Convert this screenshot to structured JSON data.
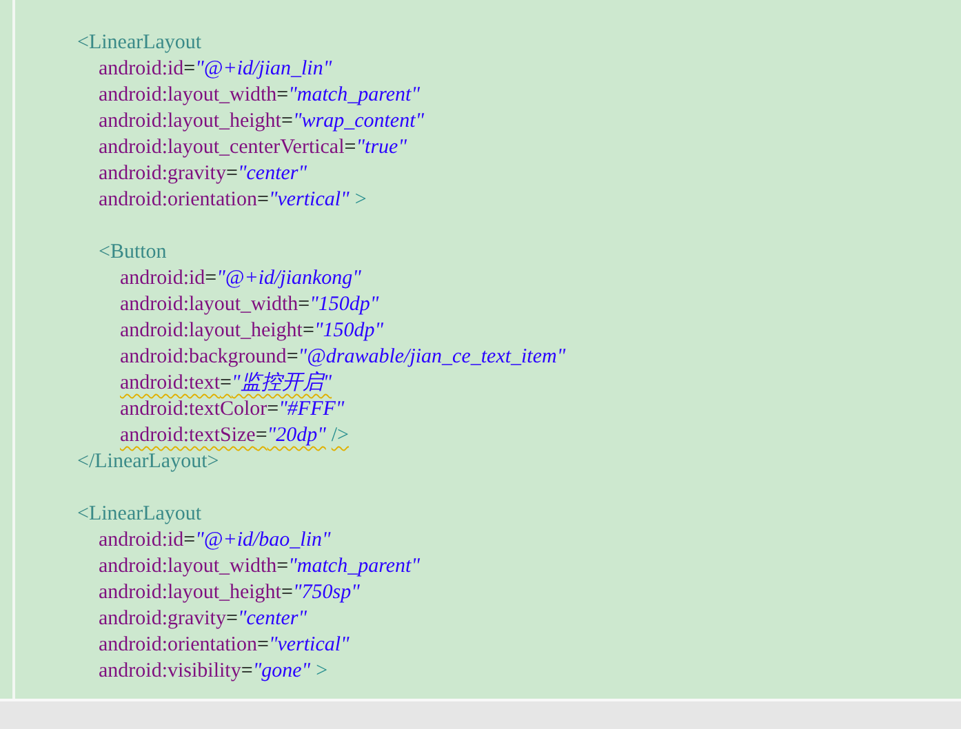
{
  "editor": {
    "lines": [
      {
        "kind": "open",
        "tokens": [
          {
            "kind": "tag",
            "text": "<LinearLayout"
          }
        ],
        "children": [
          {
            "kind": "attr",
            "tokens": [
              {
                "kind": "attr",
                "text": "android:id"
              },
              {
                "kind": "eq",
                "text": "="
              },
              {
                "kind": "value",
                "text": "\"@+id/jian_lin\""
              }
            ]
          },
          {
            "kind": "attr",
            "tokens": [
              {
                "kind": "attr",
                "text": "android:layout_width"
              },
              {
                "kind": "eq",
                "text": "="
              },
              {
                "kind": "value",
                "text": "\"match_parent\""
              }
            ]
          },
          {
            "kind": "attr",
            "tokens": [
              {
                "kind": "attr",
                "text": "android:layout_height"
              },
              {
                "kind": "eq",
                "text": "="
              },
              {
                "kind": "value",
                "text": "\"wrap_content\""
              }
            ]
          },
          {
            "kind": "attr",
            "tokens": [
              {
                "kind": "attr",
                "text": "android:layout_centerVertical"
              },
              {
                "kind": "eq",
                "text": "="
              },
              {
                "kind": "value",
                "text": "\"true\""
              }
            ]
          },
          {
            "kind": "attr",
            "tokens": [
              {
                "kind": "attr",
                "text": "android:gravity"
              },
              {
                "kind": "eq",
                "text": "="
              },
              {
                "kind": "value",
                "text": "\"center\""
              }
            ]
          },
          {
            "kind": "attr",
            "tokens": [
              {
                "kind": "attr",
                "text": "android:orientation"
              },
              {
                "kind": "eq",
                "text": "="
              },
              {
                "kind": "value",
                "text": "\"vertical\""
              },
              {
                "kind": "punct",
                "text": ">"
              }
            ]
          },
          {
            "kind": "open",
            "tokens": [
              {
                "kind": "tag",
                "text": "<Button"
              }
            ],
            "children": [
              {
                "kind": "attr",
                "tokens": [
                  {
                    "kind": "attr",
                    "text": "android:id"
                  },
                  {
                    "kind": "eq",
                    "text": "="
                  },
                  {
                    "kind": "value",
                    "text": "\"@+id/jiankong\""
                  }
                ]
              },
              {
                "kind": "attr",
                "tokens": [
                  {
                    "kind": "attr",
                    "text": "android:layout_width"
                  },
                  {
                    "kind": "eq",
                    "text": "="
                  },
                  {
                    "kind": "value",
                    "text": "\"150dp\""
                  }
                ]
              },
              {
                "kind": "attr",
                "tokens": [
                  {
                    "kind": "attr",
                    "text": "android:layout_height"
                  },
                  {
                    "kind": "eq",
                    "text": "="
                  },
                  {
                    "kind": "value",
                    "text": "\"150dp\""
                  }
                ]
              },
              {
                "kind": "attr",
                "tokens": [
                  {
                    "kind": "attr",
                    "text": "android:background"
                  },
                  {
                    "kind": "eq",
                    "text": "="
                  },
                  {
                    "kind": "value",
                    "text": "\"@drawable/jian_ce_text_item\""
                  }
                ]
              },
              {
                "kind": "attr",
                "warning": true,
                "tokens": [
                  {
                    "kind": "attr",
                    "text": "android:text"
                  },
                  {
                    "kind": "eq",
                    "text": "="
                  },
                  {
                    "kind": "value",
                    "text": "\"监控开启\""
                  }
                ]
              },
              {
                "kind": "attr",
                "tokens": [
                  {
                    "kind": "attr",
                    "text": "android:textColor"
                  },
                  {
                    "kind": "eq",
                    "text": "="
                  },
                  {
                    "kind": "value",
                    "text": "\"#FFF\""
                  }
                ]
              },
              {
                "kind": "attr",
                "warning": true,
                "tokens": [
                  {
                    "kind": "attr",
                    "text": "android:textSize"
                  },
                  {
                    "kind": "eq",
                    "text": "="
                  },
                  {
                    "kind": "value",
                    "text": "\"20dp\""
                  },
                  {
                    "kind": "punct",
                    "text": "/>"
                  }
                ]
              }
            ]
          }
        ]
      },
      {
        "kind": "close",
        "tokens": [
          {
            "kind": "tag",
            "text": "</LinearLayout>"
          }
        ]
      },
      {
        "kind": "open",
        "tokens": [
          {
            "kind": "tag",
            "text": "<LinearLayout"
          }
        ],
        "children": [
          {
            "kind": "attr",
            "tokens": [
              {
                "kind": "attr",
                "text": "android:id"
              },
              {
                "kind": "eq",
                "text": "="
              },
              {
                "kind": "value",
                "text": "\"@+id/bao_lin\""
              }
            ]
          },
          {
            "kind": "attr",
            "tokens": [
              {
                "kind": "attr",
                "text": "android:layout_width"
              },
              {
                "kind": "eq",
                "text": "="
              },
              {
                "kind": "value",
                "text": "\"match_parent\""
              }
            ]
          },
          {
            "kind": "attr",
            "tokens": [
              {
                "kind": "attr",
                "text": "android:layout_height"
              },
              {
                "kind": "eq",
                "text": "="
              },
              {
                "kind": "value",
                "text": "\"750sp\""
              }
            ]
          },
          {
            "kind": "attr",
            "tokens": [
              {
                "kind": "attr",
                "text": "android:gravity"
              },
              {
                "kind": "eq",
                "text": "="
              },
              {
                "kind": "value",
                "text": "\"center\""
              }
            ]
          },
          {
            "kind": "attr",
            "tokens": [
              {
                "kind": "attr",
                "text": "android:orientation"
              },
              {
                "kind": "eq",
                "text": "="
              },
              {
                "kind": "value",
                "text": "\"vertical\""
              }
            ]
          },
          {
            "kind": "attr",
            "tokens": [
              {
                "kind": "attr",
                "text": "android:visibility"
              },
              {
                "kind": "eq",
                "text": "="
              },
              {
                "kind": "value",
                "text": "\"gone\""
              },
              {
                "kind": "punct",
                "text": ">"
              }
            ]
          }
        ]
      }
    ]
  }
}
